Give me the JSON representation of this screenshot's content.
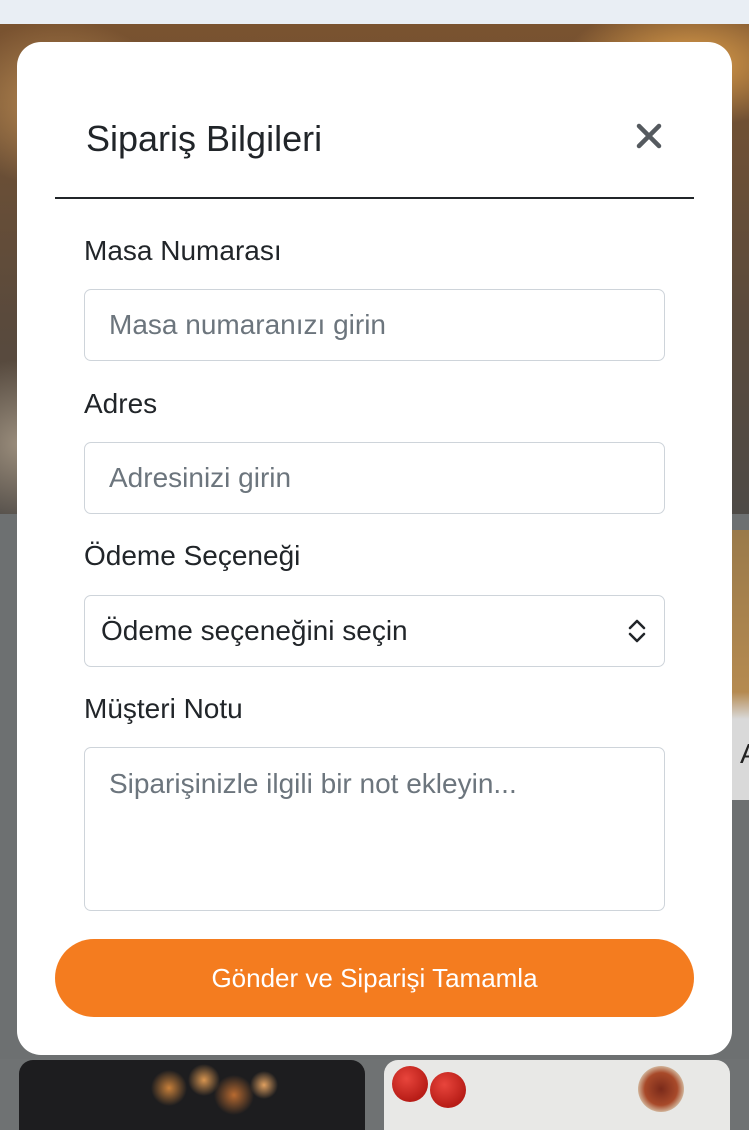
{
  "modal": {
    "title": "Sipariş Bilgileri",
    "close_icon": "close-icon"
  },
  "form": {
    "table_number": {
      "label": "Masa Numarası",
      "value": "",
      "placeholder": "Masa numaranızı girin"
    },
    "address": {
      "label": "Adres",
      "value": "",
      "placeholder": "Adresinizi girin"
    },
    "payment": {
      "label": "Ödeme Seçeneği",
      "selected": "Ödeme seçeneğini seçin",
      "icon": "chevron-updown-icon"
    },
    "note": {
      "label": "Müşteri Notu",
      "value": "",
      "placeholder": "Siparişinizle ilgili bir not ekleyin..."
    },
    "submit_label": "Gönder ve Siparişi Tamamla"
  },
  "background": {
    "partial_card_letter": "A"
  },
  "colors": {
    "accent": "#f47c1f",
    "text": "#212529",
    "placeholder": "#6c757d",
    "border": "#ced4da",
    "overlay": "#6d7071"
  }
}
